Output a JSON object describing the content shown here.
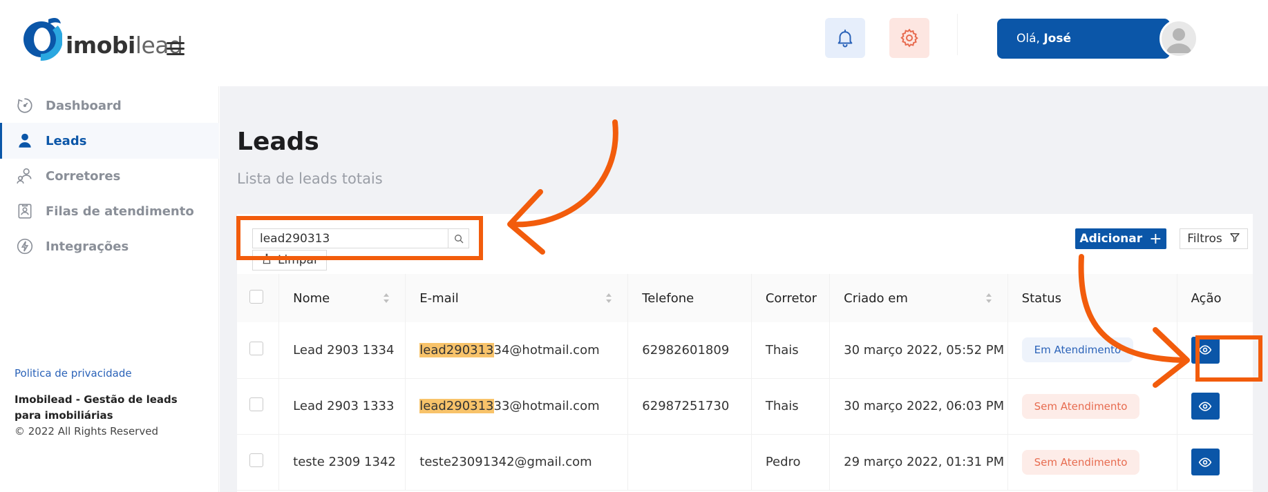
{
  "brand": {
    "logo_bold": "imobi",
    "logo_light": "lead",
    "colors": {
      "primary": "#0b56a8",
      "accent": "#f25c0c",
      "highlight": "#f8c36a"
    }
  },
  "header": {
    "greeting": "Olá,",
    "user_name": "José",
    "icons": [
      "bell-icon",
      "gear-icon",
      "avatar"
    ]
  },
  "sidebar": {
    "items": [
      {
        "label": "Dashboard",
        "icon": "dashboard-icon"
      },
      {
        "label": "Leads",
        "icon": "user-icon",
        "active": true
      },
      {
        "label": "Corretores",
        "icon": "people-icon"
      },
      {
        "label": "Filas de atendimento",
        "icon": "queue-icon"
      },
      {
        "label": "Integrações",
        "icon": "bolt-icon"
      }
    ],
    "privacy": "Politica de privacidade",
    "company": "Imobilead - Gestão de leads para imobiliárias",
    "copyright": "© 2022 All Rights Reserved"
  },
  "main": {
    "title": "Leads",
    "subtitle": "Lista de leads totais",
    "search": {
      "value": "lead290313"
    },
    "clear_label": "Limpar",
    "add_label": "Adicionar",
    "filter_label": "Filtros",
    "table": {
      "columns": [
        "Nome",
        "E-mail",
        "Telefone",
        "Corretor",
        "Criado em",
        "Status",
        "Ação"
      ],
      "rows": [
        {
          "nome": "Lead 2903 1334",
          "email_match": "lead290313",
          "email_rest": "34@hotmail.com",
          "telefone": "62982601809",
          "corretor": "Thais",
          "criado": "30 março 2022, 05:52 PM",
          "status": "Em Atendimento"
        },
        {
          "nome": "Lead 2903 1333",
          "email_match": "lead290313",
          "email_rest": "33@hotmail.com",
          "telefone": "62987251730",
          "corretor": "Thais",
          "criado": "30 março 2022, 06:03 PM",
          "status": "Sem Atendimento"
        },
        {
          "nome": "teste 2309 1342",
          "email_match": "",
          "email_rest": "teste23091342@gmail.com",
          "telefone": "",
          "corretor": "Pedro",
          "criado": "29 março 2022, 01:31 PM",
          "status": "Sem Atendimento"
        }
      ]
    }
  }
}
